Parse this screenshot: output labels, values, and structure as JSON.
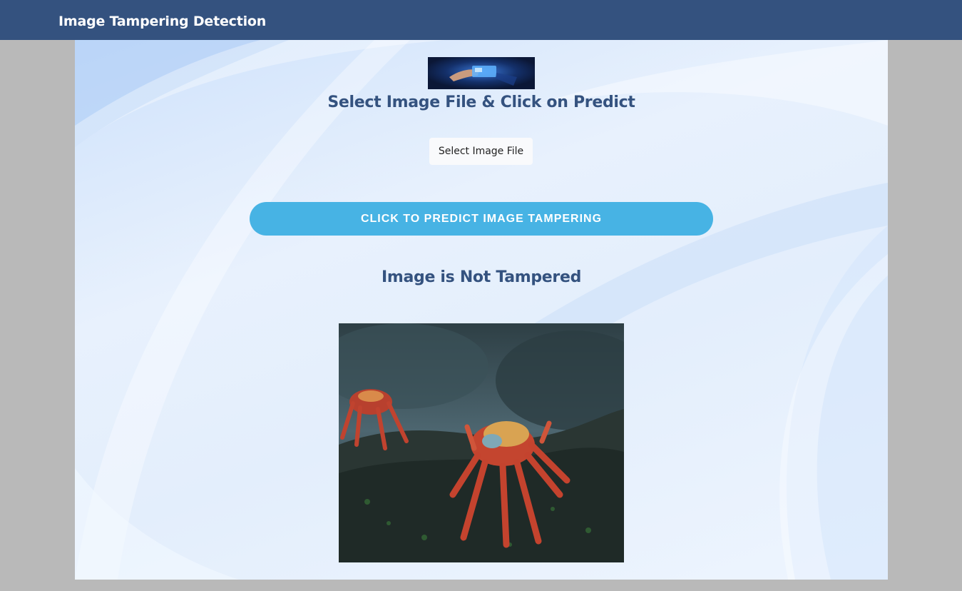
{
  "header": {
    "title": "Image Tampering Detection"
  },
  "main": {
    "banner_icon": "hand-holding-phone-image",
    "select_heading": "Select Image File & Click on Predict",
    "file_button_label": "Select Image File",
    "predict_button_label": "CLICK TO PREDICT IMAGE TAMPERING",
    "result_text": "Image is Not Tampered",
    "preview_image": "red-crabs-on-mossy-rock-photo"
  },
  "colors": {
    "header_bg": "#34527f",
    "heading_text": "#34527f",
    "predict_button_bg": "#47b3e4",
    "page_bg": "#b9b9b9"
  }
}
